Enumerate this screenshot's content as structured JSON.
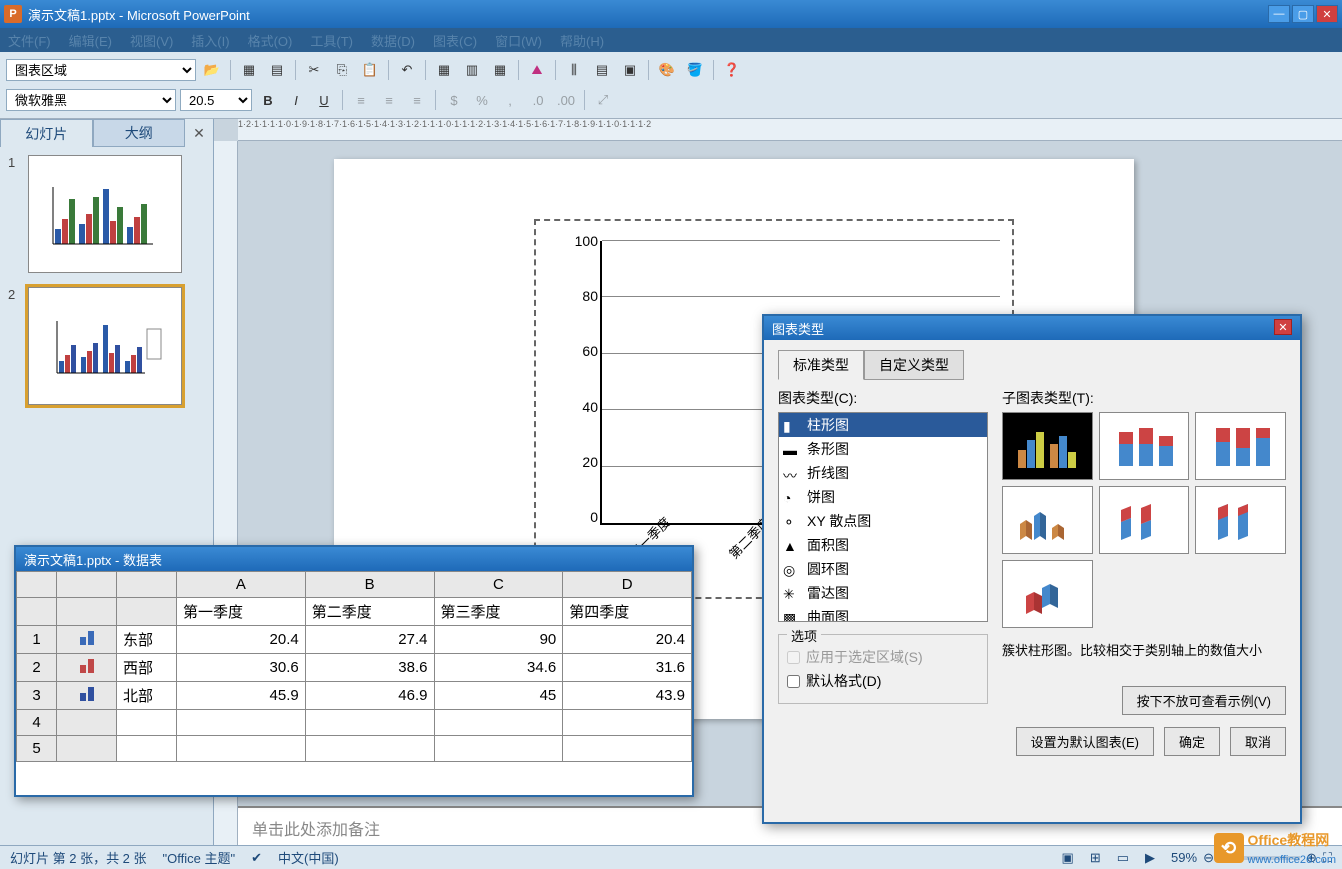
{
  "window": {
    "title": "演示文稿1.pptx - Microsoft PowerPoint",
    "app_letter": "P"
  },
  "menu": [
    "文件(F)",
    "编辑(E)",
    "视图(V)",
    "插入(I)",
    "格式(O)",
    "工具(T)",
    "数据(D)",
    "图表(C)",
    "窗口(W)",
    "帮助(H)"
  ],
  "toolbar": {
    "area_combo": "图表区域",
    "font": "微软雅黑",
    "size": "20.5"
  },
  "panel": {
    "tab_slides": "幻灯片",
    "tab_outline": "大纲",
    "slides": [
      {
        "num": "1"
      },
      {
        "num": "2"
      }
    ]
  },
  "ruler_marks": "1·2·1·1·1·1·0·1·9·1·8·1·7·1·6·1·5·1·4·1·3·1·2·1·1·1·0·1·1·1·2·1·3·1·4·1·5·1·6·1·7·1·8·1·9·1·1·0·1·1·1·2",
  "notes_placeholder": "单击此处添加备注",
  "status": {
    "slide_info": "幻灯片 第 2 张，共 2 张",
    "theme": "\"Office 主题\"",
    "lang": "中文(中国)",
    "zoom": "59%"
  },
  "datasheet": {
    "title": "演示文稿1.pptx - 数据表",
    "columns": [
      "A",
      "B",
      "C",
      "D"
    ],
    "headers": [
      "第一季度",
      "第二季度",
      "第三季度",
      "第四季度"
    ],
    "rows": [
      {
        "num": "1",
        "label": "东部",
        "icon_colors": [
          "#3a6ab8",
          "#3a6ab8"
        ],
        "values": [
          "20.4",
          "27.4",
          "90",
          "20.4"
        ]
      },
      {
        "num": "2",
        "label": "西部",
        "icon_colors": [
          "#c04848",
          "#c04848"
        ],
        "values": [
          "30.6",
          "38.6",
          "34.6",
          "31.6"
        ]
      },
      {
        "num": "3",
        "label": "北部",
        "icon_colors": [
          "#3050a0",
          "#3050a0"
        ],
        "values": [
          "45.9",
          "46.9",
          "45",
          "43.9"
        ]
      },
      {
        "num": "4",
        "label": "",
        "values": [
          "",
          "",
          "",
          ""
        ]
      },
      {
        "num": "5",
        "label": "",
        "values": [
          "",
          "",
          "",
          ""
        ]
      }
    ]
  },
  "dialog": {
    "title": "图表类型",
    "tab_standard": "标准类型",
    "tab_custom": "自定义类型",
    "chart_type_label": "图表类型(C):",
    "sub_type_label": "子图表类型(T):",
    "chart_types": [
      "柱形图",
      "条形图",
      "折线图",
      "饼图",
      "XY 散点图",
      "面积图",
      "圆环图",
      "雷达图",
      "曲面图"
    ],
    "options_legend": "选项",
    "opt_apply": "应用于选定区域(S)",
    "opt_default": "默认格式(D)",
    "description": "簇状柱形图。比较相交于类别轴上的数值大小",
    "sample_btn": "按下不放可查看示例(V)",
    "set_default_btn": "设置为默认图表(E)",
    "ok_btn": "确定",
    "cancel_btn": "取消"
  },
  "chart_data": {
    "type": "bar",
    "title": "",
    "categories": [
      "第一季度",
      "第二季度",
      "第三季度",
      "第四季度"
    ],
    "series": [
      {
        "name": "东部",
        "color": "#2a5aa8",
        "values": [
          20.4,
          27.4,
          90,
          20.4
        ]
      },
      {
        "name": "西部",
        "color": "#c04040",
        "values": [
          30.6,
          38.6,
          34.6,
          31.6
        ]
      },
      {
        "name": "北部",
        "color": "#3050a0",
        "values": [
          45.9,
          46.9,
          45,
          43.9
        ]
      }
    ],
    "y_ticks": [
      0,
      20,
      40,
      60,
      80,
      100
    ],
    "ylim": [
      0,
      100
    ],
    "xlabel": "",
    "ylabel": ""
  },
  "watermark": {
    "brand": "Office",
    "suffix": "教程网",
    "url": "www.office26.com"
  }
}
